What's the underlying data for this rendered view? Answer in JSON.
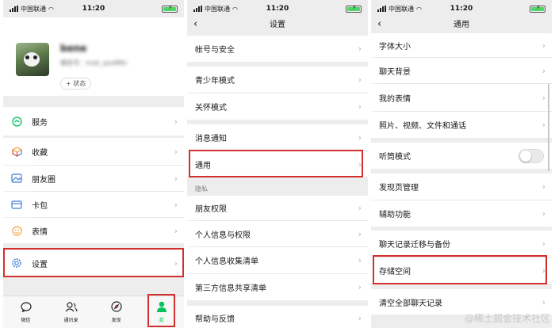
{
  "status_bar": {
    "carrier": "中国联通",
    "time": "11:20",
    "battery": "⚡"
  },
  "me": {
    "profile": {
      "name": "bene",
      "wechat_id": "微信号：mxb_qzx88ls",
      "status_label": "+ 状态"
    },
    "items": [
      {
        "label": "服务",
        "icon": "service-icon"
      },
      {
        "label": "收藏",
        "icon": "favorites-icon"
      },
      {
        "label": "朋友圈",
        "icon": "moments-icon"
      },
      {
        "label": "卡包",
        "icon": "card-wallet-icon"
      },
      {
        "label": "表情",
        "icon": "sticker-icon"
      },
      {
        "label": "设置",
        "icon": "settings-icon"
      }
    ],
    "tabs": [
      {
        "label": "微信",
        "icon": "chat-icon"
      },
      {
        "label": "通讯录",
        "icon": "contacts-icon"
      },
      {
        "label": "发现",
        "icon": "discover-icon"
      },
      {
        "label": "我",
        "icon": "me-icon"
      }
    ]
  },
  "settings": {
    "title": "设置",
    "items": [
      "帐号与安全",
      "青少年模式",
      "关怀模式",
      "消息通知",
      "通用",
      "朋友权限",
      "个人信息与权限",
      "个人信息收集清单",
      "第三方信息共享清单",
      "帮助与反馈"
    ],
    "section_privacy": "隐私"
  },
  "general": {
    "title": "通用",
    "items": [
      "字体大小",
      "聊天背景",
      "我的表情",
      "照片、视频、文件和通话",
      "听筒模式",
      "发现页管理",
      "辅助功能",
      "聊天记录迁移与备份",
      "存储空间",
      "清空全部聊天记录"
    ]
  },
  "watermark": "@稀土掘金技术社区",
  "colors": {
    "accent": "#07c160",
    "highlight": "#d32f2f",
    "background": "#ededed"
  }
}
